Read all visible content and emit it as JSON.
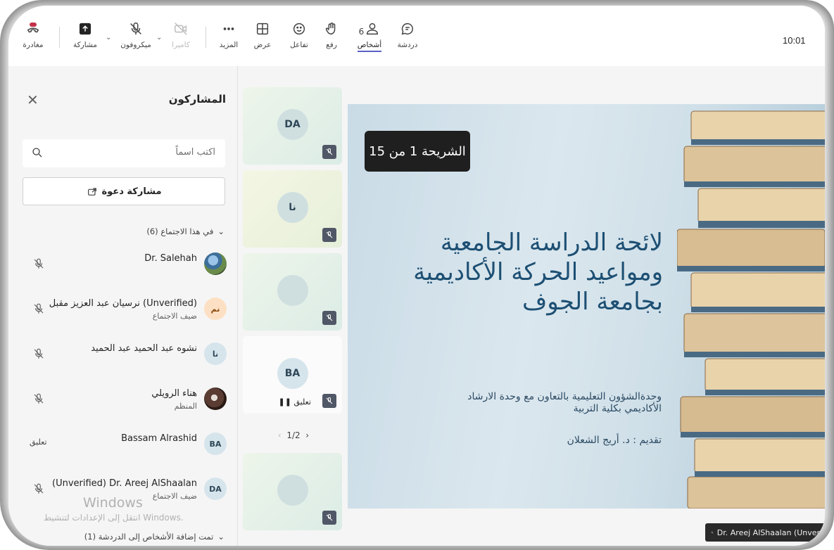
{
  "toolbar": {
    "chat": "دردشة",
    "people": "أشخاص",
    "people_count": "6",
    "raise": "رفع",
    "react": "تفاعل",
    "view": "عرض",
    "more": "المزيد",
    "camera": "كاميرا",
    "mic": "ميكروفون",
    "share": "مشاركة",
    "leave": "مغادرة",
    "clock": "10:01"
  },
  "panel": {
    "title": "المشاركون",
    "search_placeholder": "اكتب اسماً",
    "invite_label": "مشاركة دعوة",
    "in_meeting": "في هذا الاجتماع (6)",
    "participants": [
      {
        "name": "Dr. Salehah",
        "sub": "",
        "initials": ""
      },
      {
        "name": "نرسيان عبد العزيز مقبل (Unverified)",
        "sub": "ضيف الاجتماع",
        "initials": "نم"
      },
      {
        "name": "نشوه عبد الحميد عبد الحميد",
        "sub": "",
        "initials": "نا"
      },
      {
        "name": "هناء الرويلي",
        "sub": "المنظم",
        "initials": ""
      },
      {
        "name": "Bassam Alrashid",
        "sub": "",
        "initials": "BA",
        "status": "تعليق"
      },
      {
        "name": "(Unverified) Dr. Areej AlShaalan",
        "sub": "ضيف الاجتماع",
        "initials": "DA"
      }
    ],
    "watermark_title": "Windows",
    "watermark_sub": "انتقل إلى الإعدادات لتنشيط Windows.",
    "added_to_chat": "تمت إضافة الأشخاص إلى الدردشة (1)"
  },
  "tiles": {
    "t1": "DA",
    "t2": "نا",
    "t4": "BA",
    "t4_status": "تعليق",
    "pager": "1/2"
  },
  "slide": {
    "badge": "الشريحة 1 من 15",
    "title_l1": "لائحة الدراسة الجامعية",
    "title_l2": "ومواعيد الحركة الأكاديمية",
    "title_l3": "بجامعة الجوف",
    "sub_l1": "وحدةالشؤون التعليمية بالتعاون مع وحدة الارشاد",
    "sub_l2": "الأكاديمي بكلية التربية",
    "presenter": "تقديم : د. أريج الشعلان",
    "caption": "Dr. Areej AlShaalan (Unverif"
  },
  "colors": {
    "accent": "#5b5fc7",
    "leave": "#c4314b",
    "slide_title": "#1d4f73"
  }
}
